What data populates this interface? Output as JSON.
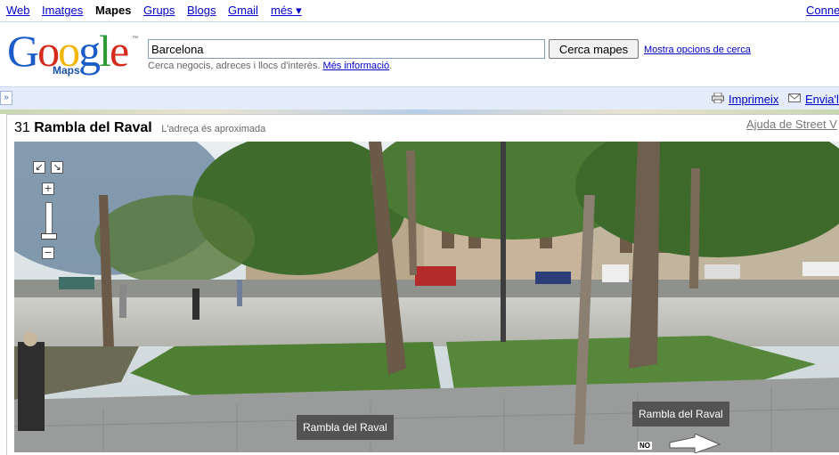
{
  "nav": {
    "items": [
      "Web",
      "Imatges",
      "Mapes",
      "Grups",
      "Blogs",
      "Gmail",
      "més ▾"
    ],
    "signin": "Conne"
  },
  "logo": {
    "text": "Google",
    "product": "Maps",
    "tm": "™"
  },
  "search": {
    "value": "Barcelona",
    "button": "Cerca mapes",
    "more_options": "Mostra opcions de cerca",
    "hint_text": "Cerca negocis, adreces i llocs d'interès.",
    "hint_link": "Més informació"
  },
  "toolbar": {
    "collapse": "»",
    "print": "Imprimeix",
    "send": "Envia'l"
  },
  "streetview": {
    "number": "31",
    "street": "Rambla del Raval",
    "approx_note": "L'adreça és aproximada",
    "help": "Ajuda de Street V",
    "labels": [
      "Rambla del Raval",
      "Rambla del Raval"
    ],
    "compass": "NO"
  },
  "colors": {
    "sky": "#dfe6e9",
    "foliage": "#3f6b2c",
    "pavement": "#bdbdb8",
    "grass": "#4f7f33"
  }
}
